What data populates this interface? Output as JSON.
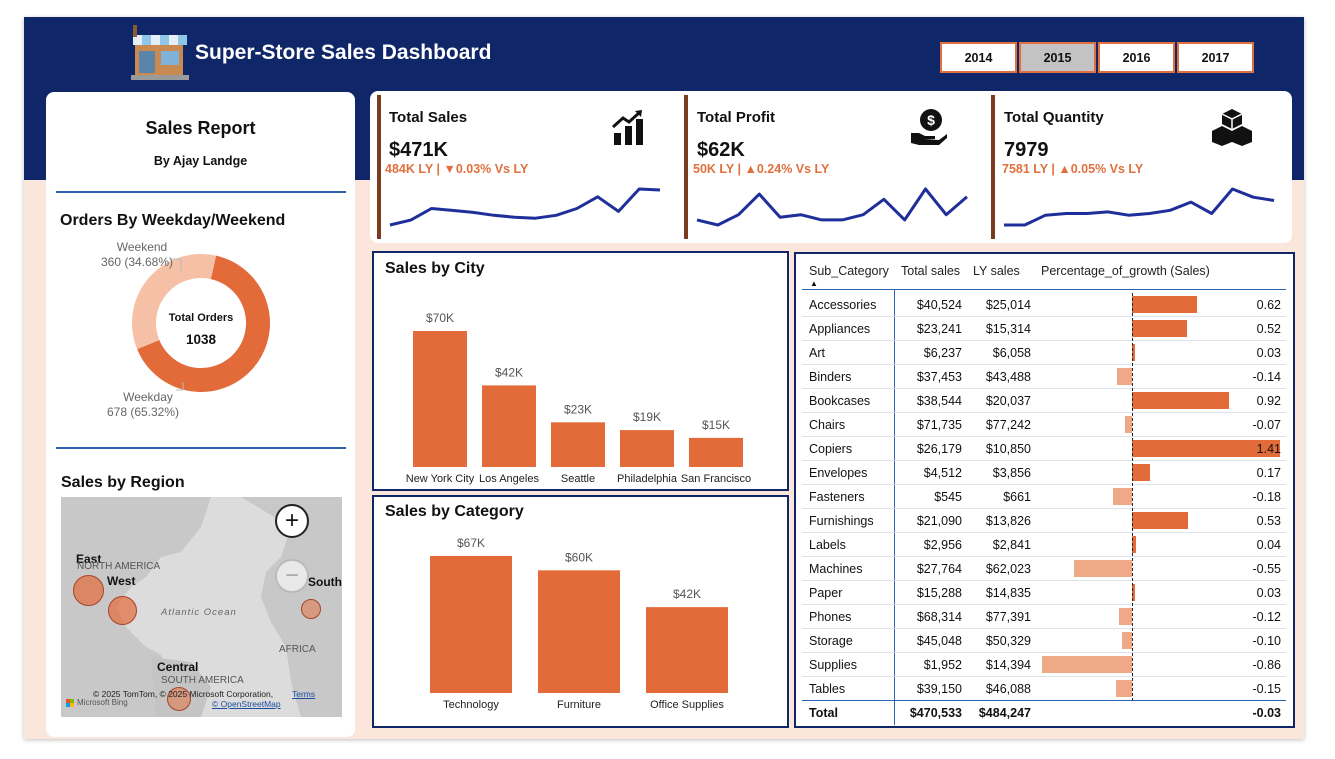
{
  "header": {
    "title": "Super-Store Sales Dashboard",
    "years": [
      "2014",
      "2015",
      "2016",
      "2017"
    ],
    "selected_year": "2015"
  },
  "report": {
    "title": "Sales Report",
    "author": "By Ajay Landge"
  },
  "orders": {
    "title": "Orders By Weekday/Weekend",
    "center_label": "Total Orders",
    "center_value": "1038",
    "weekend_label": "Weekend",
    "weekend_value": "360 (34.68%)",
    "weekday_label": "Weekday",
    "weekday_value": "678 (65.32%)",
    "chart_data": {
      "type": "pie",
      "categories": [
        "Weekday",
        "Weekend"
      ],
      "values": [
        678,
        360
      ],
      "colors": [
        "#e36b3a",
        "#f5c0a5"
      ]
    }
  },
  "region": {
    "title": "Sales by Region",
    "map_labels": [
      "East",
      "West",
      "South",
      "Central"
    ],
    "geo_labels": [
      "NORTH AMERICA",
      "Atlantic Ocean",
      "AFRICA",
      "SOUTH AMERICA"
    ],
    "attribution": "© 2025 TomTom, © 2025 Microsoft Corporation,",
    "terms": "Terms",
    "osm": "© OpenStreetMap",
    "bing": "Microsoft Bing",
    "zoom_in": "+",
    "zoom_out": "−"
  },
  "kpis": [
    {
      "label": "Total Sales",
      "value": "$471K",
      "ly": "484K LY",
      "sep": "|",
      "arrow": "▼",
      "change": "0.03% Vs LY",
      "icon": "growth-chart-icon",
      "spark": [
        28,
        33,
        45,
        43,
        41,
        38,
        36,
        35,
        38,
        45,
        57,
        42,
        65,
        64
      ]
    },
    {
      "label": "Total Profit",
      "value": "$62K",
      "ly": "50K LY",
      "sep": "|",
      "arrow": "▲",
      "change": "0.24% Vs LY",
      "icon": "money-hand-icon",
      "spark": [
        40,
        38,
        42,
        50,
        41,
        42,
        40,
        40,
        42,
        48,
        40,
        52,
        42,
        49
      ]
    },
    {
      "label": "Total Quantity",
      "value": "7979",
      "ly": "7581 LY",
      "sep": "|",
      "arrow": "▲",
      "change": "0.05% Vs LY",
      "icon": "boxes-icon",
      "spark": [
        38,
        38,
        44,
        45,
        45,
        46,
        44,
        45,
        47,
        52,
        45,
        60,
        55,
        53
      ]
    }
  ],
  "city": {
    "title": "Sales by City",
    "chart_data": {
      "type": "bar",
      "categories": [
        "New York City",
        "Los Angeles",
        "Seattle",
        "Philadelphia",
        "San Francisco"
      ],
      "values": [
        70,
        42,
        23,
        19,
        15
      ],
      "labels": [
        "$70K",
        "$42K",
        "$23K",
        "$19K",
        "$15K"
      ],
      "unit": "$K",
      "ylim": [
        0,
        70
      ],
      "color": "#e36b3a"
    }
  },
  "category": {
    "title": "Sales by Category",
    "chart_data": {
      "type": "bar",
      "categories": [
        "Technology",
        "Furniture",
        "Office Supplies"
      ],
      "values": [
        67,
        60,
        42
      ],
      "labels": [
        "$67K",
        "$60K",
        "$42K"
      ],
      "unit": "$K",
      "ylim": [
        0,
        67
      ],
      "color": "#e36b3a"
    }
  },
  "table": {
    "headers": [
      "Sub_Category",
      "Total sales",
      "LY sales",
      "Percentage_of_growth (Sales)"
    ],
    "sort_indicator": "▲",
    "rows": [
      {
        "name": "Accessories",
        "sales": "$40,524",
        "ly": "$25,014",
        "growth": 0.62,
        "growth_text": "0.62"
      },
      {
        "name": "Appliances",
        "sales": "$23,241",
        "ly": "$15,314",
        "growth": 0.52,
        "growth_text": "0.52"
      },
      {
        "name": "Art",
        "sales": "$6,237",
        "ly": "$6,058",
        "growth": 0.03,
        "growth_text": "0.03"
      },
      {
        "name": "Binders",
        "sales": "$37,453",
        "ly": "$43,488",
        "growth": -0.14,
        "growth_text": "-0.14"
      },
      {
        "name": "Bookcases",
        "sales": "$38,544",
        "ly": "$20,037",
        "growth": 0.92,
        "growth_text": "0.92"
      },
      {
        "name": "Chairs",
        "sales": "$71,735",
        "ly": "$77,242",
        "growth": -0.07,
        "growth_text": "-0.07"
      },
      {
        "name": "Copiers",
        "sales": "$26,179",
        "ly": "$10,850",
        "growth": 1.41,
        "growth_text": "1.41"
      },
      {
        "name": "Envelopes",
        "sales": "$4,512",
        "ly": "$3,856",
        "growth": 0.17,
        "growth_text": "0.17"
      },
      {
        "name": "Fasteners",
        "sales": "$545",
        "ly": "$661",
        "growth": -0.18,
        "growth_text": "-0.18"
      },
      {
        "name": "Furnishings",
        "sales": "$21,090",
        "ly": "$13,826",
        "growth": 0.53,
        "growth_text": "0.53"
      },
      {
        "name": "Labels",
        "sales": "$2,956",
        "ly": "$2,841",
        "growth": 0.04,
        "growth_text": "0.04"
      },
      {
        "name": "Machines",
        "sales": "$27,764",
        "ly": "$62,023",
        "growth": -0.55,
        "growth_text": "-0.55"
      },
      {
        "name": "Paper",
        "sales": "$15,288",
        "ly": "$14,835",
        "growth": 0.03,
        "growth_text": "0.03"
      },
      {
        "name": "Phones",
        "sales": "$68,314",
        "ly": "$77,391",
        "growth": -0.12,
        "growth_text": "-0.12"
      },
      {
        "name": "Storage",
        "sales": "$45,048",
        "ly": "$50,329",
        "growth": -0.1,
        "growth_text": "-0.10"
      },
      {
        "name": "Supplies",
        "sales": "$1,952",
        "ly": "$14,394",
        "growth": -0.86,
        "growth_text": "-0.86"
      },
      {
        "name": "Tables",
        "sales": "$39,150",
        "ly": "$46,088",
        "growth": -0.15,
        "growth_text": "-0.15"
      }
    ],
    "total": {
      "name": "Total",
      "sales": "$470,533",
      "ly": "$484,247",
      "growth_text": "-0.03"
    },
    "positive_color": "#e36b3a",
    "negative_color": "#f0a987"
  }
}
